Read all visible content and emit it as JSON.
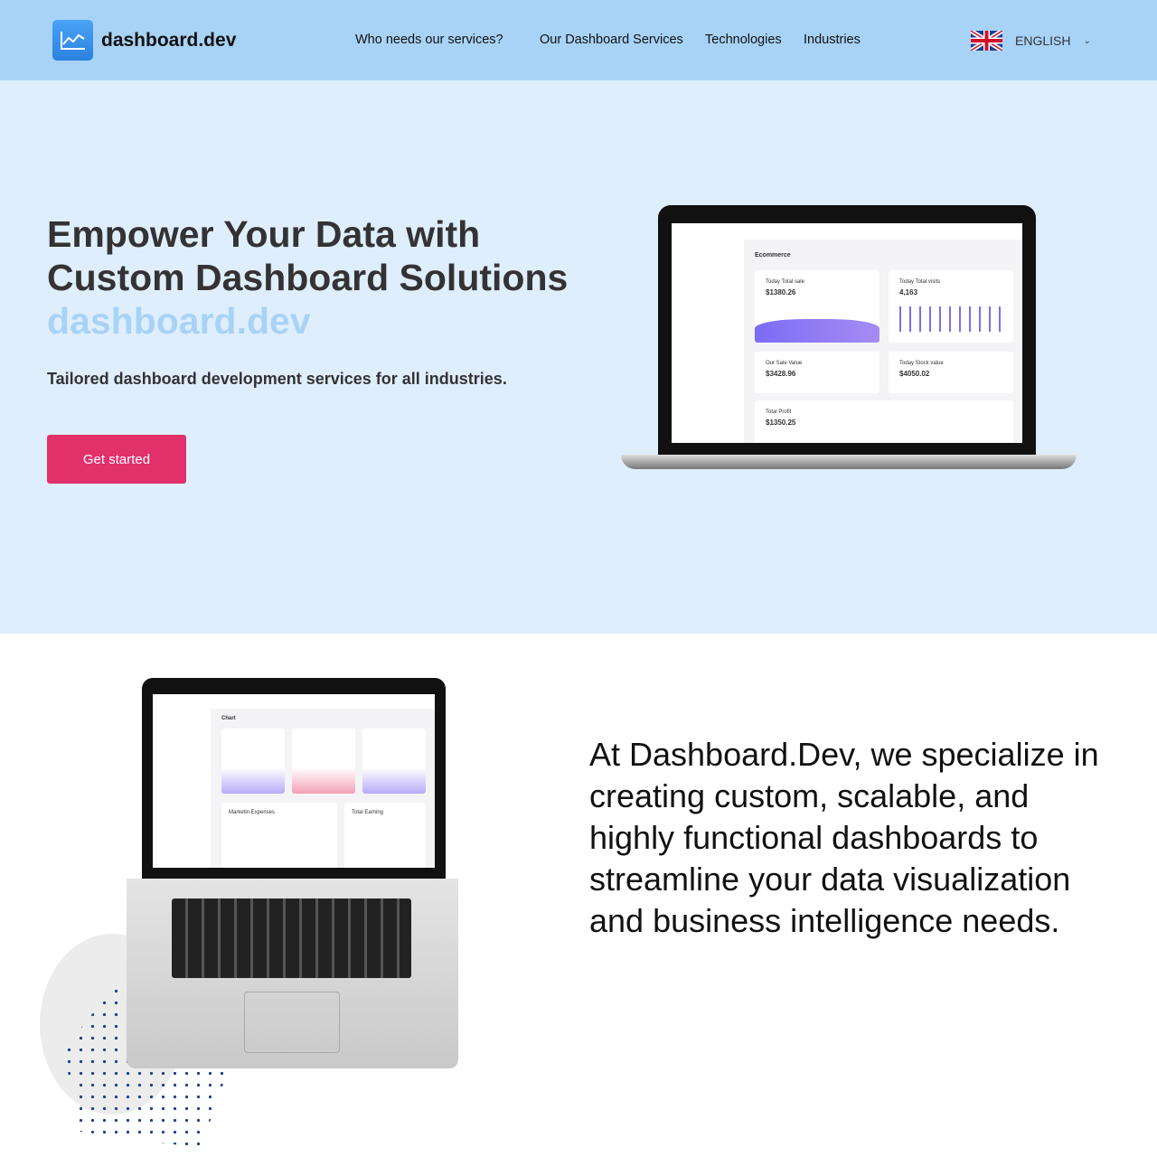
{
  "header": {
    "logo_text": "dashboard.dev",
    "nav": [
      "Who needs our services?",
      "Our Dashboard Services",
      "Technologies",
      "Industries"
    ],
    "language": "ENGLISH"
  },
  "hero": {
    "title_line1": "Empower Your Data with",
    "title_line2": "Custom Dashboard Solutions",
    "brand": "dashboard.dev",
    "subtitle": "Tailored dashboard development services for all industries.",
    "cta": "Get started"
  },
  "mockup1": {
    "page_title": "Ecommerce",
    "cards": [
      {
        "label": "Today Total sale",
        "value": "$1380.26"
      },
      {
        "label": "Today Total visits",
        "value": "4,163"
      },
      {
        "label": "Our Sale Value",
        "value": "$3428.96"
      },
      {
        "label": "Today Stock value",
        "value": "$4050.02"
      },
      {
        "label": "Total Profit",
        "value": "$1350.25"
      }
    ]
  },
  "mockup2": {
    "page_title": "Chart",
    "cards": [
      "Marketin Expenses",
      "Total Earning"
    ]
  },
  "about": {
    "text": "At Dashboard.Dev, we specialize in creating custom, scalable, and highly functional dashboards to streamline your data visualization and business intelligence needs."
  },
  "colors": {
    "header": "#a8d3f7",
    "hero_bg": "#dfeefd",
    "cta": "#e2306b"
  }
}
